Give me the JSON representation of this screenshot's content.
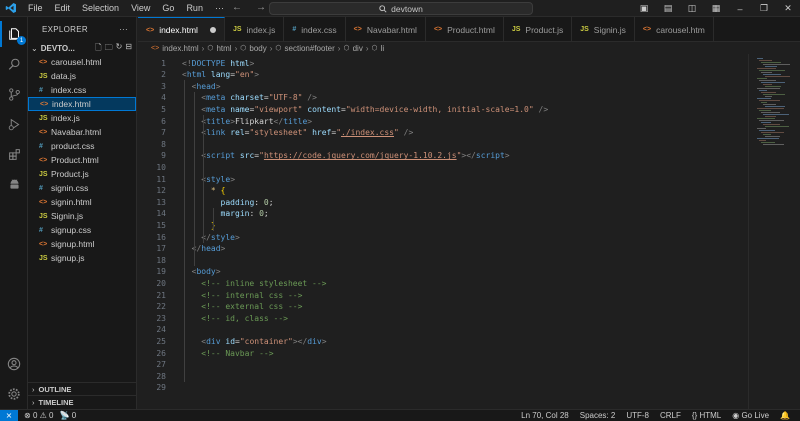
{
  "titlebar": {
    "menu": [
      "File",
      "Edit",
      "Selection",
      "View",
      "Go",
      "Run",
      "···"
    ],
    "search_text": "devtown"
  },
  "activity": {
    "source_control_badge": "1"
  },
  "sidebar": {
    "title": "EXPLORER",
    "root": "DEVTO...",
    "files": [
      {
        "type": "html",
        "name": "carousel.html"
      },
      {
        "type": "js",
        "name": "data.js"
      },
      {
        "type": "css",
        "name": "index.css"
      },
      {
        "type": "html",
        "name": "index.html"
      },
      {
        "type": "js",
        "name": "index.js"
      },
      {
        "type": "html",
        "name": "Navabar.html"
      },
      {
        "type": "css",
        "name": "product.css"
      },
      {
        "type": "html",
        "name": "Product.html"
      },
      {
        "type": "js",
        "name": "Product.js"
      },
      {
        "type": "css",
        "name": "signin.css"
      },
      {
        "type": "html",
        "name": "signin.html"
      },
      {
        "type": "js",
        "name": "Signin.js"
      },
      {
        "type": "css",
        "name": "signup.css"
      },
      {
        "type": "html",
        "name": "signup.html"
      },
      {
        "type": "js",
        "name": "signup.js"
      }
    ],
    "active_index": 3,
    "outline": "OUTLINE",
    "timeline": "TIMELINE"
  },
  "tabs": [
    {
      "type": "html",
      "label": "index.html",
      "active": true,
      "modified": true
    },
    {
      "type": "js",
      "label": "index.js"
    },
    {
      "type": "css",
      "label": "index.css"
    },
    {
      "type": "html",
      "label": "Navabar.html"
    },
    {
      "type": "html",
      "label": "Product.html"
    },
    {
      "type": "js",
      "label": "Product.js"
    },
    {
      "type": "js",
      "label": "Signin.js"
    },
    {
      "type": "html",
      "label": "carousel.htm"
    }
  ],
  "breadcrumb": [
    "index.html",
    "html",
    "body",
    "section#footer",
    "div",
    "li"
  ],
  "editor": {
    "lines": [
      {
        "n": "1",
        "indent": 0,
        "tokens": [
          [
            "t-pun",
            "<!"
          ],
          [
            "t-tag",
            "DOCTYPE"
          ],
          [
            "t-txt",
            " "
          ],
          [
            "t-attr",
            "html"
          ],
          [
            "t-pun",
            ">"
          ]
        ]
      },
      {
        "n": "2",
        "indent": 0,
        "tokens": [
          [
            "t-pun",
            "<"
          ],
          [
            "t-tag",
            "html"
          ],
          [
            "t-txt",
            " "
          ],
          [
            "t-attr",
            "lang"
          ],
          [
            "t-txt",
            "="
          ],
          [
            "t-str",
            "\"en\""
          ],
          [
            "t-pun",
            ">"
          ]
        ]
      },
      {
        "n": "3",
        "indent": 1,
        "tokens": [
          [
            "t-pun",
            "<"
          ],
          [
            "t-tag",
            "head"
          ],
          [
            "t-pun",
            ">"
          ]
        ]
      },
      {
        "n": "4",
        "indent": 2,
        "tokens": [
          [
            "t-pun",
            "<"
          ],
          [
            "t-tag",
            "meta"
          ],
          [
            "t-txt",
            " "
          ],
          [
            "t-attr",
            "charset"
          ],
          [
            "t-txt",
            "="
          ],
          [
            "t-str",
            "\"UTF-8\""
          ],
          [
            "t-txt",
            " "
          ],
          [
            "t-pun",
            "/>"
          ]
        ]
      },
      {
        "n": "5",
        "indent": 2,
        "tokens": [
          [
            "t-pun",
            "<"
          ],
          [
            "t-tag",
            "meta"
          ],
          [
            "t-txt",
            " "
          ],
          [
            "t-attr",
            "name"
          ],
          [
            "t-txt",
            "="
          ],
          [
            "t-str",
            "\"viewport\""
          ],
          [
            "t-txt",
            " "
          ],
          [
            "t-attr",
            "content"
          ],
          [
            "t-txt",
            "="
          ],
          [
            "t-str",
            "\"width=device-width, initial-scale=1.0\""
          ],
          [
            "t-txt",
            " "
          ],
          [
            "t-pun",
            "/>"
          ]
        ]
      },
      {
        "n": "6",
        "indent": 2,
        "tokens": [
          [
            "t-pun",
            "<"
          ],
          [
            "t-tag",
            "title"
          ],
          [
            "t-pun",
            ">"
          ],
          [
            "t-txt",
            "Flipkart"
          ],
          [
            "t-pun",
            "</"
          ],
          [
            "t-tag",
            "title"
          ],
          [
            "t-pun",
            ">"
          ]
        ]
      },
      {
        "n": "7",
        "indent": 2,
        "tokens": [
          [
            "t-pun",
            "<"
          ],
          [
            "t-tag",
            "link"
          ],
          [
            "t-txt",
            " "
          ],
          [
            "t-attr",
            "rel"
          ],
          [
            "t-txt",
            "="
          ],
          [
            "t-str",
            "\"stylesheet\""
          ],
          [
            "t-txt",
            " "
          ],
          [
            "t-attr",
            "href"
          ],
          [
            "t-txt",
            "="
          ],
          [
            "t-str",
            "\""
          ],
          [
            "t-str t-url",
            "./index.css"
          ],
          [
            "t-str",
            "\""
          ],
          [
            "t-txt",
            " "
          ],
          [
            "t-pun",
            "/>"
          ]
        ]
      },
      {
        "n": "8",
        "indent": 2,
        "tokens": []
      },
      {
        "n": "9",
        "indent": 2,
        "tokens": [
          [
            "t-pun",
            "<"
          ],
          [
            "t-tag",
            "script"
          ],
          [
            "t-txt",
            " "
          ],
          [
            "t-attr",
            "src"
          ],
          [
            "t-txt",
            "="
          ],
          [
            "t-str",
            "\""
          ],
          [
            "t-str t-url",
            "https://code.jquery.com/jquery-1.10.2.js"
          ],
          [
            "t-str",
            "\""
          ],
          [
            "t-pun",
            "></"
          ],
          [
            "t-tag",
            "script"
          ],
          [
            "t-pun",
            ">"
          ]
        ]
      },
      {
        "n": "10",
        "indent": 2,
        "tokens": []
      },
      {
        "n": "11",
        "indent": 2,
        "tokens": [
          [
            "t-pun",
            "<"
          ],
          [
            "t-tag",
            "style"
          ],
          [
            "t-pun",
            ">"
          ]
        ]
      },
      {
        "n": "12",
        "indent": 3,
        "tokens": [
          [
            "t-sel",
            "*"
          ],
          [
            "t-txt",
            " "
          ],
          [
            "t-br",
            "{"
          ]
        ]
      },
      {
        "n": "13",
        "indent": 4,
        "tokens": [
          [
            "t-prop",
            "padding"
          ],
          [
            "t-txt",
            ": "
          ],
          [
            "t-num",
            "0"
          ],
          [
            "t-txt",
            ";"
          ]
        ]
      },
      {
        "n": "14",
        "indent": 4,
        "tokens": [
          [
            "t-prop",
            "margin"
          ],
          [
            "t-txt",
            ": "
          ],
          [
            "t-num",
            "0"
          ],
          [
            "t-txt",
            ";"
          ]
        ]
      },
      {
        "n": "15",
        "indent": 3,
        "tokens": [
          [
            "t-br",
            "}"
          ]
        ]
      },
      {
        "n": "16",
        "indent": 2,
        "tokens": [
          [
            "t-pun",
            "</"
          ],
          [
            "t-tag",
            "style"
          ],
          [
            "t-pun",
            ">"
          ]
        ]
      },
      {
        "n": "17",
        "indent": 1,
        "tokens": [
          [
            "t-pun",
            "</"
          ],
          [
            "t-tag",
            "head"
          ],
          [
            "t-pun",
            ">"
          ]
        ]
      },
      {
        "n": "18",
        "indent": 1,
        "tokens": []
      },
      {
        "n": "19",
        "indent": 1,
        "tokens": [
          [
            "t-pun",
            "<"
          ],
          [
            "t-tag",
            "body"
          ],
          [
            "t-pun",
            ">"
          ]
        ]
      },
      {
        "n": "20",
        "indent": 2,
        "tokens": [
          [
            "t-cmt",
            "<!-- inline stylesheet -->"
          ]
        ]
      },
      {
        "n": "21",
        "indent": 2,
        "tokens": [
          [
            "t-cmt",
            "<!-- internal css -->"
          ]
        ]
      },
      {
        "n": "22",
        "indent": 2,
        "tokens": [
          [
            "t-cmt",
            "<!-- external css -->"
          ]
        ]
      },
      {
        "n": "23",
        "indent": 2,
        "tokens": [
          [
            "t-cmt",
            "<!-- id, class -->"
          ]
        ]
      },
      {
        "n": "24",
        "indent": 2,
        "tokens": []
      },
      {
        "n": "25",
        "indent": 2,
        "tokens": [
          [
            "t-pun",
            "<"
          ],
          [
            "t-tag",
            "div"
          ],
          [
            "t-txt",
            " "
          ],
          [
            "t-attr",
            "id"
          ],
          [
            "t-txt",
            "="
          ],
          [
            "t-str",
            "\"container\""
          ],
          [
            "t-pun",
            "></"
          ],
          [
            "t-tag",
            "div"
          ],
          [
            "t-pun",
            ">"
          ]
        ]
      },
      {
        "n": "26",
        "indent": 2,
        "tokens": [
          [
            "t-cmt",
            "<!-- Navbar -->"
          ]
        ]
      },
      {
        "n": "27",
        "indent": 2,
        "tokens": []
      },
      {
        "n": "28",
        "indent": 2,
        "tokens": []
      },
      {
        "n": "29",
        "indent": 2,
        "tokens": []
      }
    ]
  },
  "statusbar": {
    "errors": "0",
    "warnings": "0",
    "ports": "0",
    "position": "Ln 70, Col 28",
    "spaces": "Spaces: 2",
    "encoding": "UTF-8",
    "eol": "CRLF",
    "language": "HTML",
    "golive": "Go Live"
  },
  "colors": {
    "accent": "#0078d4",
    "html_icon": "#e37933",
    "js_icon": "#cbcb41",
    "css_icon": "#519aba"
  }
}
